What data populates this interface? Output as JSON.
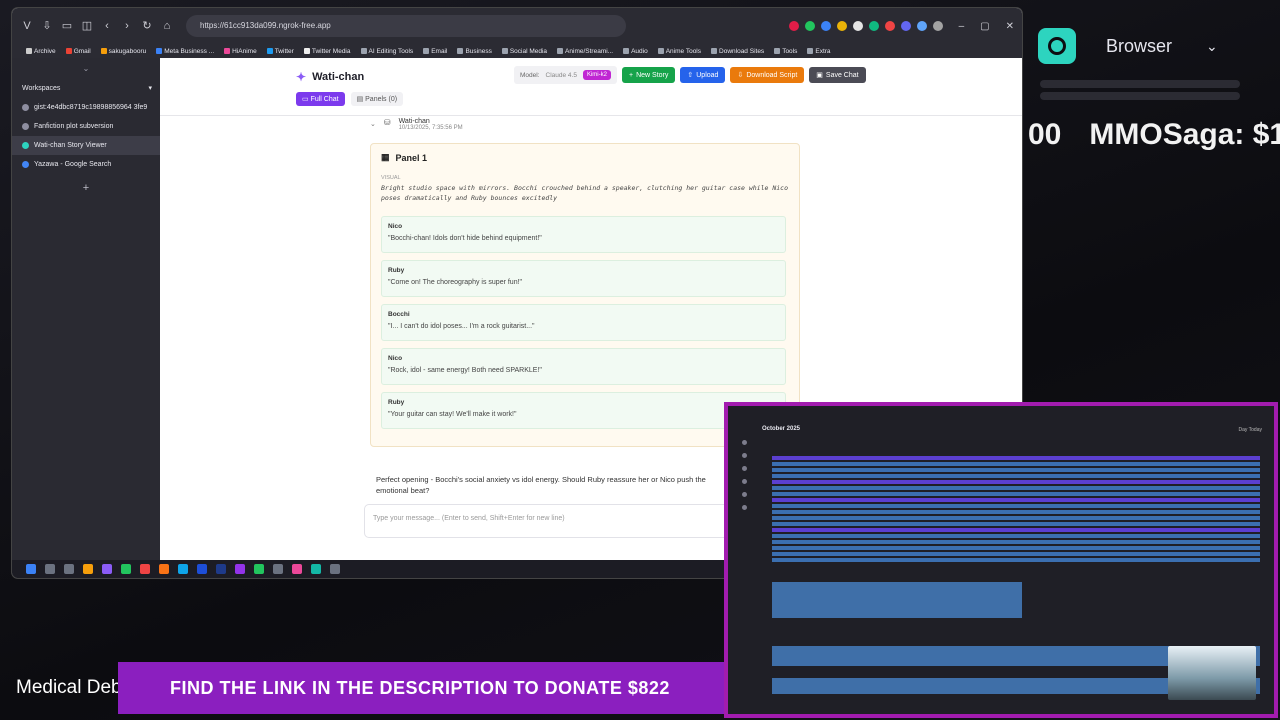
{
  "browser": {
    "url": "https://61cc913da099.ngrok-free.app",
    "bookmarks": [
      "Archive",
      "Gmail",
      "sakugabooru",
      "Meta Business ...",
      "HiAnime",
      "Twitter",
      "Twitter Media",
      "AI Editing Tools",
      "Email",
      "Business",
      "Social Media",
      "Anime/Streami...",
      "Audio",
      "Anime Tools",
      "Download Sites",
      "Tools",
      "Extra"
    ]
  },
  "sidebar": {
    "workspaces_label": "Workspaces",
    "items": [
      {
        "label": "gist:4e4dbc8719c19898856964 3fe9"
      },
      {
        "label": "Fanfiction plot subversion"
      },
      {
        "label": "Wati-chan Story Viewer"
      },
      {
        "label": "Yazawa - Google Search"
      }
    ],
    "add_label": "+"
  },
  "app": {
    "title": "Wati-chan",
    "tab_full_chat": "Full Chat",
    "tab_panels": "Panels (0)",
    "model_label": "Model:",
    "model_value": "Claude 4.5",
    "model_pill": "Kimi-k2",
    "new_story": "New Story",
    "upload": "Upload",
    "download_script": "Download Script",
    "save_chat": "Save Chat"
  },
  "message": {
    "author": "Wati-chan",
    "timestamp": "10/13/2025, 7:35:56 PM",
    "panel_title": "Panel 1",
    "visual_label": "VISUAL",
    "visual_text": "Bright studio space with mirrors. Bocchi crouched behind a speaker, clutching her guitar case while Nico poses dramatically and Ruby bounces excitedly",
    "dialogue": [
      {
        "speaker": "Nico",
        "line": "\"Bocchi-chan! Idols don't hide behind equipment!\""
      },
      {
        "speaker": "Ruby",
        "line": "\"Come on! The choreography is super fun!\""
      },
      {
        "speaker": "Bocchi",
        "line": "\"I... I can't do idol poses... I'm a rock guitarist...\""
      },
      {
        "speaker": "Nico",
        "line": "\"Rock, idol - same energy! Both need SPARKLE!\""
      },
      {
        "speaker": "Ruby",
        "line": "\"Your guitar can stay! We'll make it work!\""
      }
    ],
    "reply_text": "Perfect opening - Bocchi's social anxiety vs idol energy. Should Ruby reassure her or Nico push the emotional beat?"
  },
  "input": {
    "placeholder": "Type your message... (Enter to send, Shift+Enter for new line)"
  },
  "overlay": {
    "browser_dropdown": "Browser",
    "ticker_right_num": "00",
    "ticker_right_text": "MMOSaga: $1",
    "ticker_bottom_left": "Medical Debt",
    "ticker_bottom_main": "FIND THE LINK IN THE DESCRIPTION TO DONATE  $822"
  },
  "calendar": {
    "title": "October 2025",
    "nav": "Day   Today"
  },
  "colors": {
    "accent": "#7c3aed",
    "overlay_purple": "#8b1fbf",
    "teal": "#2dd4bf"
  }
}
